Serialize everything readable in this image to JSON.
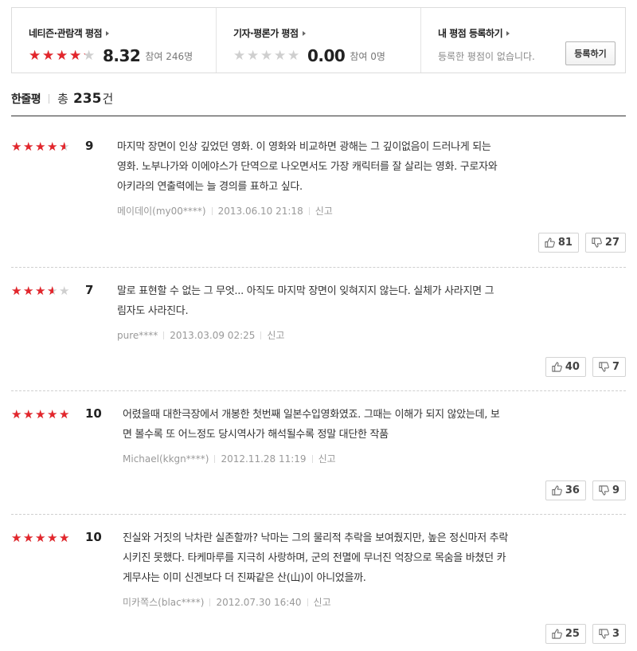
{
  "score_box": {
    "netizen": {
      "title": "네티즌·관람객 평점",
      "rating": 8.32,
      "score": "8.32",
      "participants": "참여 246명"
    },
    "critic": {
      "title": "기자·평론가 평점",
      "rating": 0,
      "score": "0.00",
      "participants": "참여 0명"
    },
    "mine": {
      "title": "내 평점 등록하기",
      "empty_text": "등록한 평점이 없습니다.",
      "register_label": "등록하기"
    }
  },
  "summary": {
    "label": "한줄평",
    "total_prefix": "총",
    "count": "235",
    "unit": "건"
  },
  "colors": {
    "star_on": "#e3262c",
    "star_off": "#cfcfcf"
  },
  "icons": {
    "like": "thumbs-up-icon",
    "dislike": "thumbs-down-icon"
  },
  "reviews": [
    {
      "rating": 9,
      "score": "9",
      "lines": [
        "마지막 장면이 인상 깊었던 영화. 이 영화와 비교하면 광해는 그 깊이없음이 드러나게 되는",
        "영화. 노부나가와 이에야스가 단역으로 나오면서도 가장 캐릭터를 잘 살리는 영화. 구로자와",
        "아키라의 연출력에는 늘 경의를 표하고 싶다."
      ],
      "author": "메이데이(my00****)",
      "date": "2013.06.10 21:18",
      "report": "신고",
      "likes": "81",
      "dislikes": "27"
    },
    {
      "rating": 7,
      "score": "7",
      "lines": [
        "말로 표현할 수 없는 그 무엇... 아직도 마지막 장면이 잊혀지지 않는다. 실체가 사라지면 그",
        "림자도 사라진다."
      ],
      "author": "pure****",
      "date": "2013.03.09 02:25",
      "report": "신고",
      "likes": "40",
      "dislikes": "7"
    },
    {
      "rating": 10,
      "score": "10",
      "lines": [
        "어렸을때 대한극장에서 개봉한 첫번째 일본수입영화였죠. 그때는 이해가 되지 않았는데, 보",
        "면 볼수록 또 어느정도 당시역사가 해석될수록 정말 대단한 작품"
      ],
      "author": "Michael(kkgn****)",
      "date": "2012.11.28 11:19",
      "report": "신고",
      "likes": "36",
      "dislikes": "9"
    },
    {
      "rating": 10,
      "score": "10",
      "lines": [
        "진실와 거짓의 낙차란 실존할까? 낙마는 그의 물리적 추락을 보여줬지만, 높은 정신마저 추락",
        "시키진 못했다. 타케마루를 지극히 사랑하며, 군의 전멸에 무너진 억장으로 목숨을 바쳤던 카",
        "게무샤는 이미 신겐보다 더 진짜같은 산(山)이 아니었을까."
      ],
      "author": "미카쪽스(blac****)",
      "date": "2012.07.30 16:40",
      "report": "신고",
      "likes": "25",
      "dislikes": "3"
    }
  ]
}
